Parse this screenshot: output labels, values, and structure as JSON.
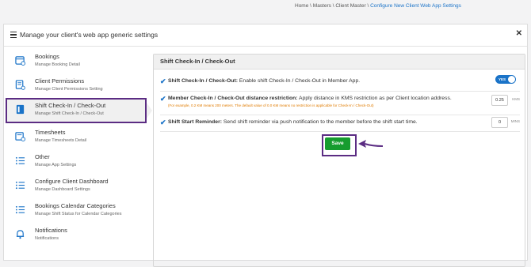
{
  "breadcrumb": {
    "home": "Home",
    "sep": "\\",
    "masters": "Masters",
    "client_master": "Client Master",
    "current": "Configure New Client Web App Settings"
  },
  "header": {
    "title": "Manage your client's web app generic settings"
  },
  "sidebar": {
    "items": [
      {
        "label": "Bookings",
        "sub": "Manage Booking Detail",
        "icon": "bookings-icon"
      },
      {
        "label": "Client Permissions",
        "sub": "Manage Client Permissions Setting",
        "icon": "permissions-icon"
      },
      {
        "label": "Shift Check-In / Check-Out",
        "sub": "Manage Shift Check-In / Check-Out",
        "icon": "check-in-icon"
      },
      {
        "label": "Timesheets",
        "sub": "Manage Timesheets Detail",
        "icon": "timesheets-icon"
      },
      {
        "label": "Other",
        "sub": "Manage App Settings",
        "icon": "list-icon"
      },
      {
        "label": "Configure Client Dashboard",
        "sub": "Manage Dashboard Settings",
        "icon": "list-icon"
      },
      {
        "label": "Bookings Calendar Categories",
        "sub": "Manage Shift Status for Calendar Categories",
        "icon": "list-icon"
      },
      {
        "label": "Notifications",
        "sub": "Notifications",
        "icon": "bell-icon"
      }
    ]
  },
  "section": {
    "title": "Shift Check-In / Check-Out",
    "rows": [
      {
        "label": "Shift Check-In / Check-Out:",
        "text": " Enable shift Check-In / Check-Out in Member App.",
        "toggle": "YES"
      },
      {
        "label": "Member Check-In / Check-Out distance restriction:",
        "text": " Apply distance in KMS restriction as per Client location address.",
        "note": "(For example, 0.2 KM means 200 meters. The default value of 0.0 KM means no restriction is applicable for Check-In / Check-Out)",
        "value": "0.25",
        "unit": "KMS"
      },
      {
        "label": "Shift Start Reminder:",
        "text": " Send shift reminder via push notification to the member before the shift start time.",
        "value": "0",
        "unit": "MINS"
      }
    ],
    "save_label": "Save"
  },
  "colors": {
    "accent": "#1a73c8",
    "highlight": "#5b2c83",
    "save": "#169c2f"
  }
}
